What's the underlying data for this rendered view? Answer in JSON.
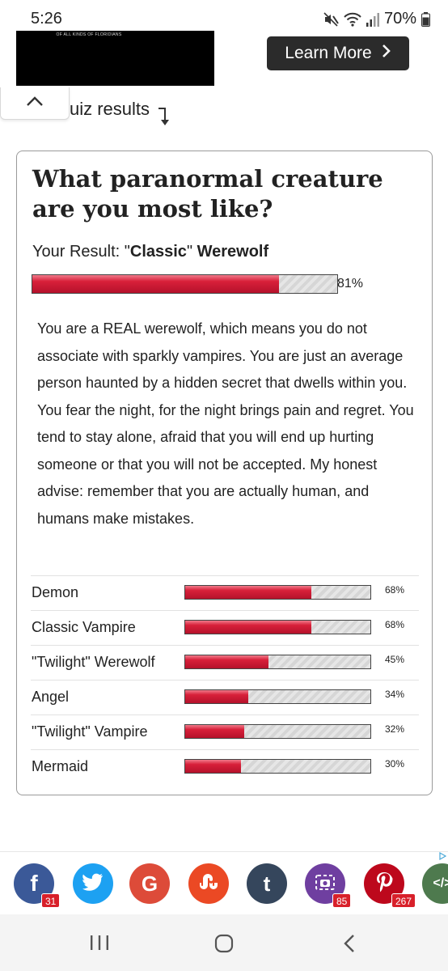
{
  "status_bar": {
    "time": "5:26",
    "battery": "70%"
  },
  "ad": {
    "image_text": "OF ALL KINDS OF FLORIDIANS",
    "button_label": "Learn More",
    "button_icon": "chevron-right-icon"
  },
  "section": {
    "label": "uiz results"
  },
  "quiz": {
    "title": "What paranormal creature are you most like?",
    "result_prefix": "Your Result: \"",
    "result_bold": "Classic",
    "result_suffix": "\" ",
    "result_name": "Werewolf",
    "result_percent": 81,
    "result_percent_label": "81%",
    "description": "You are a REAL werewolf, which means you do not associate with sparkly vampires. You are just an av­erage person haunted by a hidden secret that dwells within you. You fear the night, for the night brings pain and regret. You tend to stay alone, afraid that you will end up hurting someone or that you will not be accepted. My honest advise: remem­ber that you are actually human, and humans make mistakes.",
    "other_results": [
      {
        "label": "Demon",
        "percent": 68,
        "percent_label": "68%"
      },
      {
        "label": "Classic Vampire",
        "percent": 68,
        "percent_label": "68%"
      },
      {
        "label": "\"Twilight\" Werewolf",
        "percent": 45,
        "percent_label": "45%"
      },
      {
        "label": "Angel",
        "percent": 34,
        "percent_label": "34%"
      },
      {
        "label": "\"Twilight\" Vampire",
        "percent": 32,
        "percent_label": "32%"
      },
      {
        "label": "Mermaid",
        "percent": 30,
        "percent_label": "30%"
      }
    ]
  },
  "share": {
    "buttons": [
      {
        "icon": "facebook-icon",
        "glyph": "f",
        "color": "#3b5998",
        "count": "31"
      },
      {
        "icon": "twitter-icon",
        "glyph": "",
        "color": "#1da1f2",
        "count": ""
      },
      {
        "icon": "google-icon",
        "glyph": "G",
        "color": "#dd4b39",
        "count": ""
      },
      {
        "icon": "stumbleupon-icon",
        "glyph": "",
        "color": "#eb4924",
        "count": ""
      },
      {
        "icon": "tumblr-icon",
        "glyph": "t",
        "color": "#35465c",
        "count": ""
      },
      {
        "icon": "screenshot-icon",
        "glyph": "",
        "color": "#6f3fa0",
        "count": "85"
      },
      {
        "icon": "pinterest-icon",
        "glyph": "",
        "color": "#bd081c",
        "count": "267"
      },
      {
        "icon": "embed-icon",
        "glyph": "</>",
        "color": "#4e7a4e",
        "count": ""
      }
    ]
  },
  "colors": {
    "bar_fill": "#c8152f",
    "accent_dark": "#2b2b2b"
  }
}
